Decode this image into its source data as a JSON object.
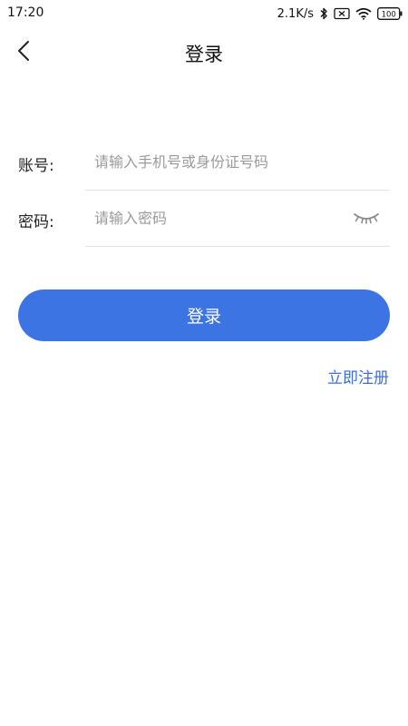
{
  "status_bar": {
    "time": "17:20",
    "net_speed": "2.1K/s",
    "battery": "100",
    "icons": [
      "bluetooth-icon",
      "sim-disabled-icon",
      "wifi-icon",
      "battery-icon"
    ]
  },
  "header": {
    "title": "登录",
    "back_icon": "chevron-left-icon"
  },
  "form": {
    "account": {
      "label": "账号:",
      "placeholder": "请输入手机号或身份证号码",
      "value": ""
    },
    "password": {
      "label": "密码:",
      "placeholder": "请输入密码",
      "value": "",
      "toggle_icon": "eye-closed-icon"
    }
  },
  "actions": {
    "login_label": "登录",
    "register_label": "立即注册"
  },
  "colors": {
    "primary": "#3c74e4",
    "link": "#3a6fd8",
    "placeholder": "#9a9a9a",
    "divider": "#e2e2e2"
  }
}
